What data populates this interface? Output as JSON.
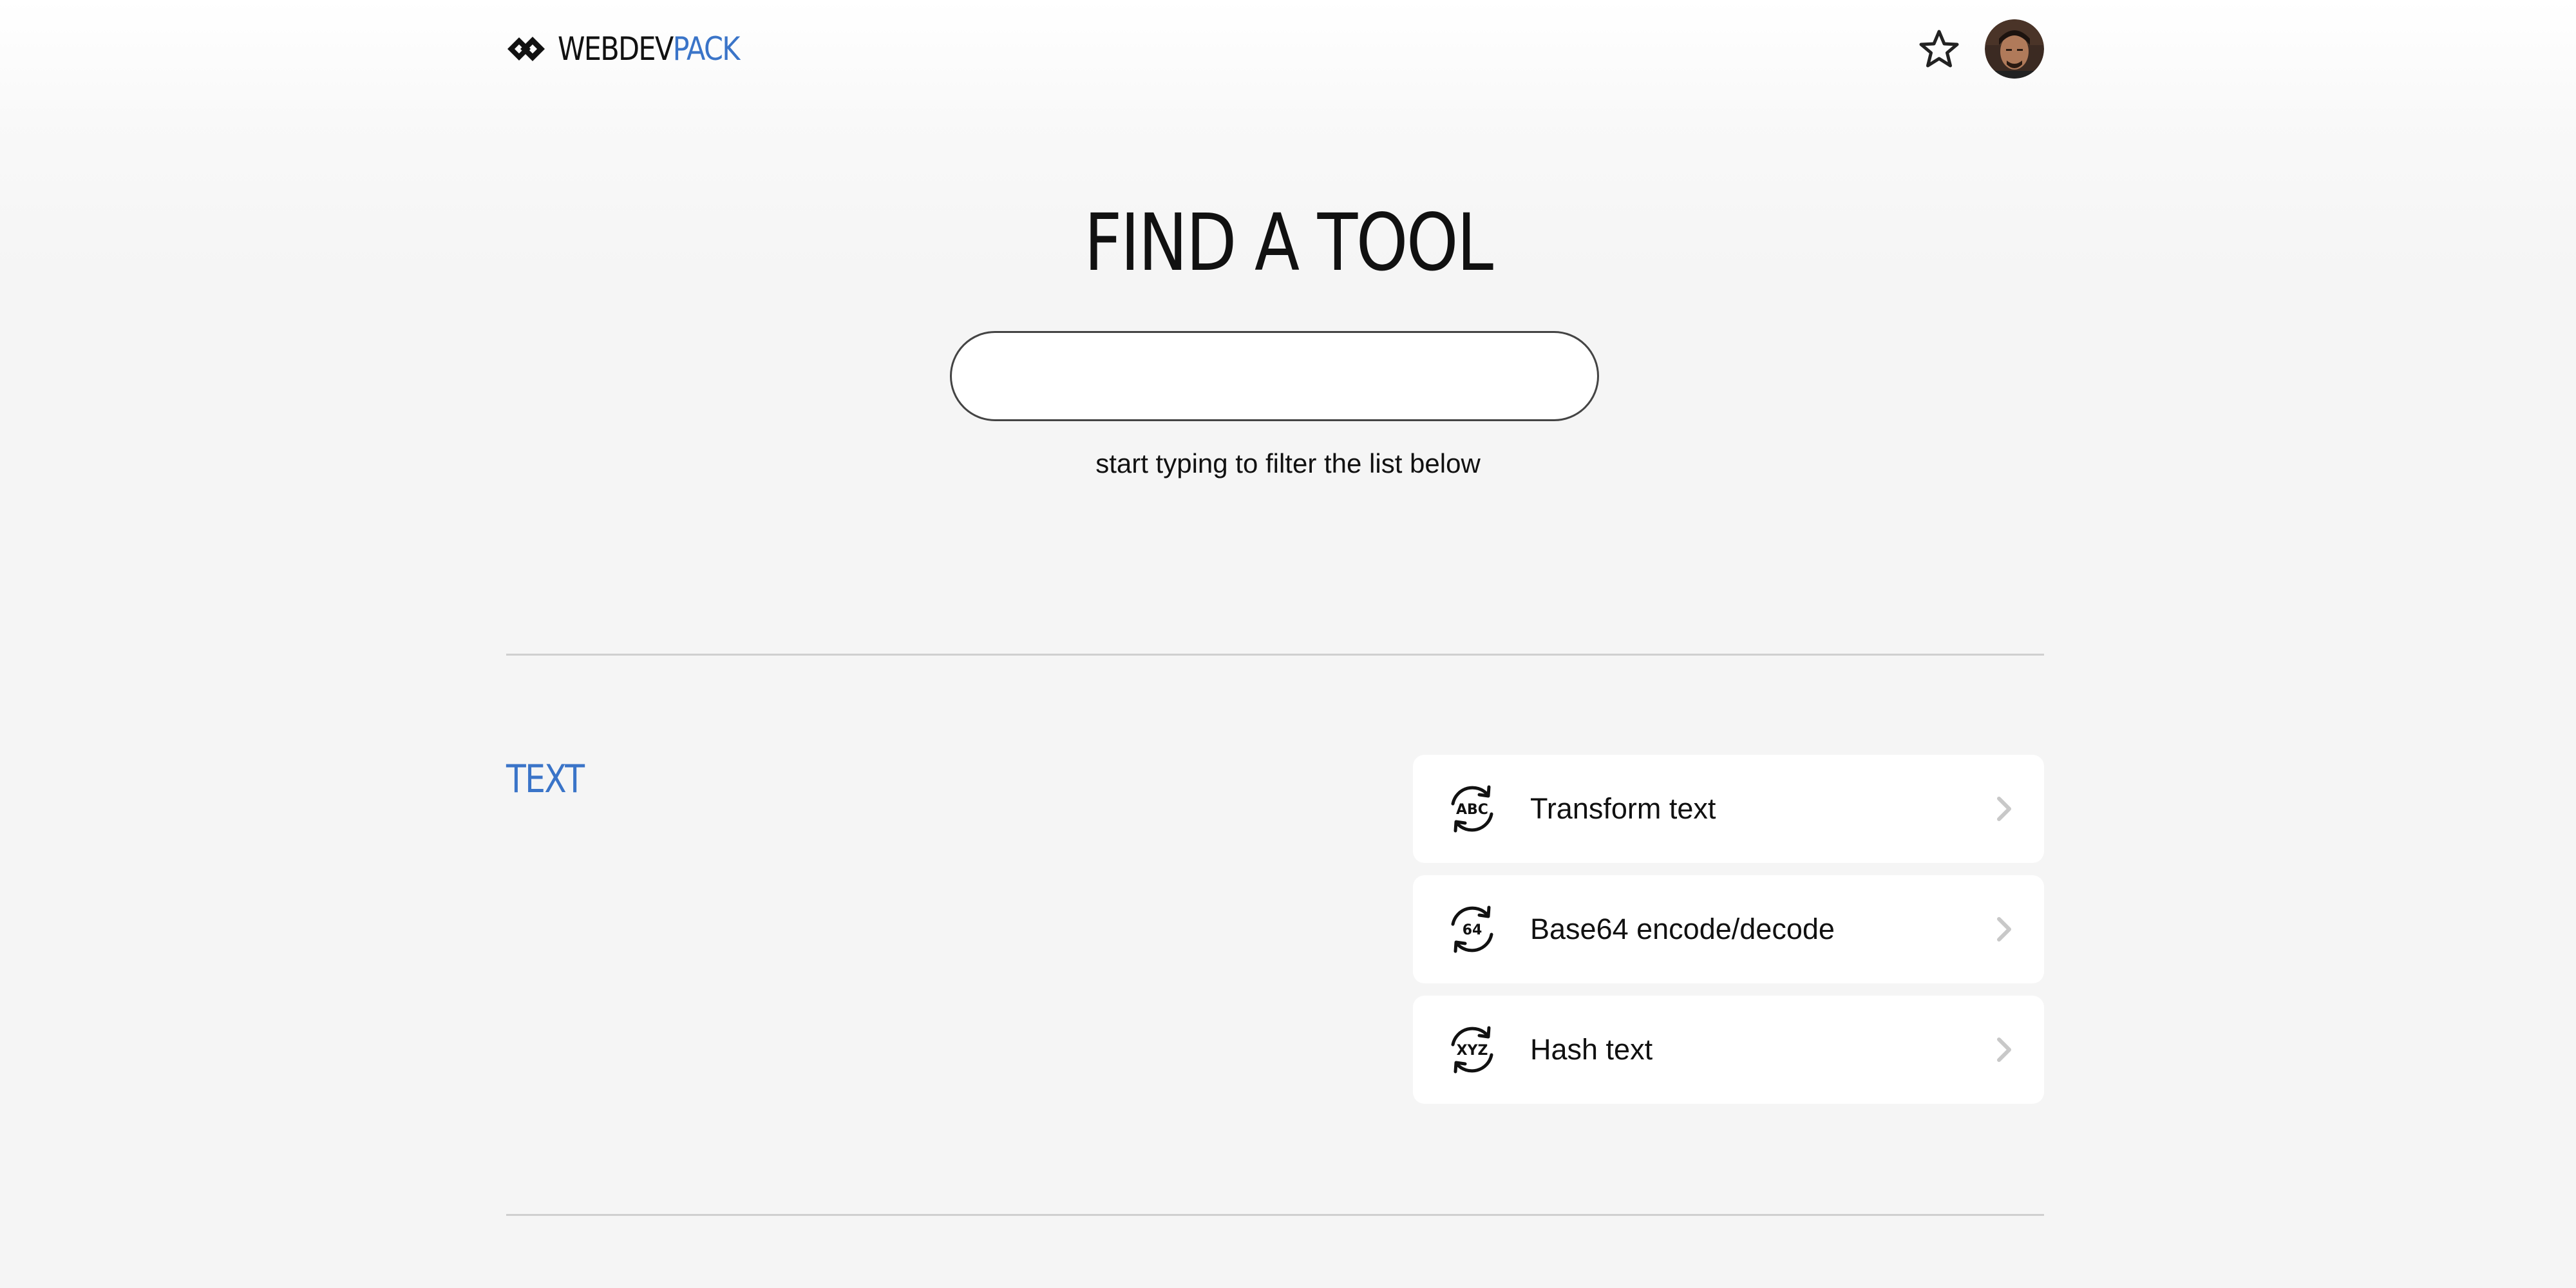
{
  "header": {
    "logo": {
      "word1": "WEBDEV",
      "word2": "PACK",
      "icon": "logo-diamonds-icon"
    },
    "favorites_icon": "star-icon",
    "avatar_icon": "user-avatar"
  },
  "hero": {
    "title": "FIND A TOOL",
    "search": {
      "value": "",
      "placeholder": ""
    },
    "hint": "start typing to filter the list below"
  },
  "sections": [
    {
      "title": "TEXT",
      "tools": [
        {
          "label": "Transform text",
          "icon": "refresh-abc-icon",
          "icon_text": "ABC"
        },
        {
          "label": "Base64 encode/decode",
          "icon": "refresh-64-icon",
          "icon_text": "64"
        },
        {
          "label": "Hash text",
          "icon": "refresh-xyz-icon",
          "icon_text": "XYZ"
        }
      ]
    }
  ],
  "colors": {
    "accent": "#3a74c8",
    "text": "#111111",
    "background": "#f5f5f5",
    "card": "#ffffff",
    "divider": "#cfcfcf",
    "chevron": "#c8c8c8"
  }
}
